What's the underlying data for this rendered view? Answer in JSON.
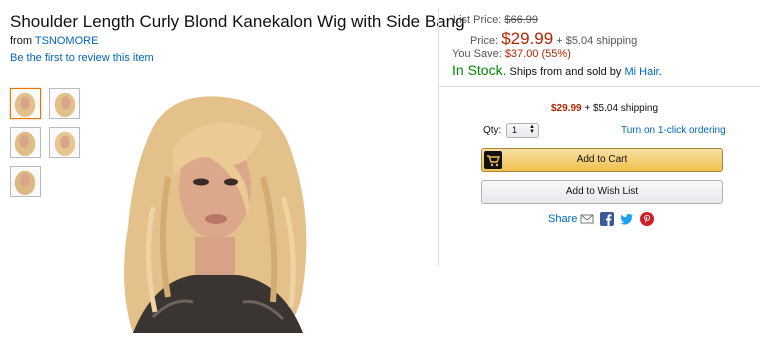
{
  "product": {
    "title": "Shoulder Length Curly Blond Kanekalon Wig with Side Bang",
    "from_label": "from",
    "brand": "TSNOMORE",
    "review_link": "Be the first to review this item"
  },
  "pricing": {
    "list_price_label": "List Price:",
    "list_price": "$66.99",
    "price_label": "Price:",
    "price": "$29.99",
    "shipping": "+ $5.04 shipping",
    "you_save_label": "You Save:",
    "you_save": "$37.00 (55%)",
    "stock": "In Stock.",
    "ships_from": "Ships from and sold by",
    "seller": "Mi Hair",
    "seller_period": "."
  },
  "buybox": {
    "price": "$29.99",
    "shipping": "+ $5.04 shipping",
    "qty_label": "Qty:",
    "qty_value": "1",
    "one_click": "Turn on 1-click ordering",
    "add_to_cart": "Add to Cart",
    "add_to_wishlist": "Add to Wish List",
    "share": "Share"
  },
  "icons": {
    "email": "email-icon",
    "facebook": "facebook-icon",
    "twitter": "twitter-icon",
    "pinterest": "pinterest-icon",
    "cart": "cart-icon"
  },
  "colors": {
    "link": "#0066c0",
    "price": "#b12704",
    "in_stock": "#008a00",
    "cart_button": "#f0c14b"
  }
}
